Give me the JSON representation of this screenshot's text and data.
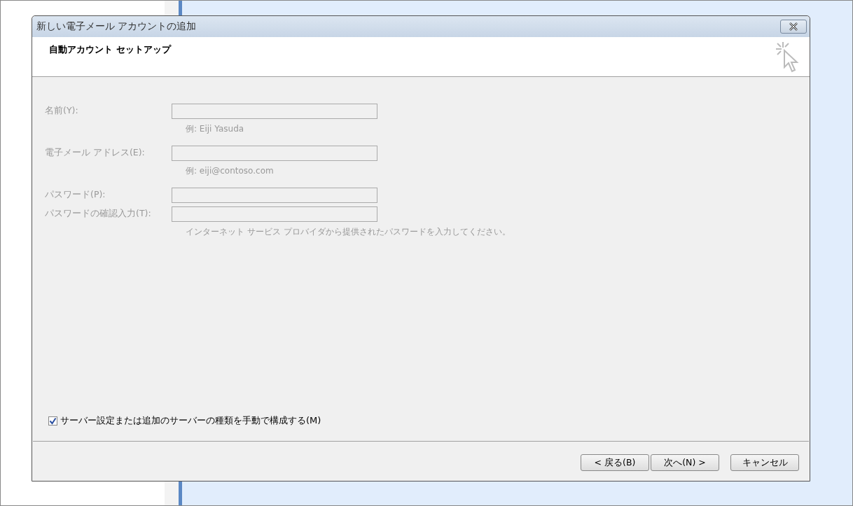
{
  "window": {
    "title": "新しい電子メール アカウントの追加"
  },
  "header": {
    "title": "自動アカウント セットアップ"
  },
  "fields": [
    {
      "label": "名前(Y):",
      "hint": "例: Eiji Yasuda",
      "disabled": true
    },
    {
      "label": "電子メール アドレス(E):",
      "hint": "例: eiji@contoso.com",
      "disabled": true
    },
    {
      "label": "パスワード(P):",
      "disabled": true
    },
    {
      "label": "パスワードの確認入力(T):",
      "hint": "インターネット サービス プロバイダから提供されたパスワードを入力してください。",
      "disabled": true
    }
  ],
  "manual_setup": {
    "label": "サーバー設定または追加のサーバーの種類を手動で構成する(M)",
    "checked": true
  },
  "buttons": [
    "< 戻る(B)",
    "次へ(N) >",
    "キャンセル"
  ]
}
